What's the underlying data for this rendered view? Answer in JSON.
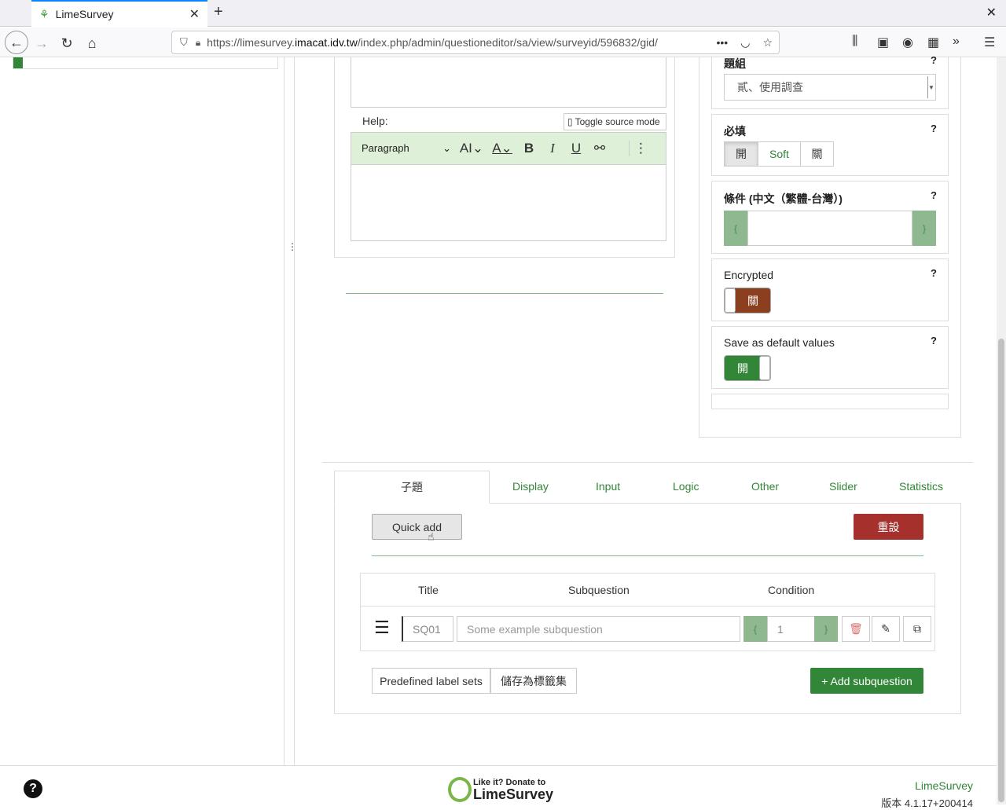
{
  "browser": {
    "tab_title": "LimeSurvey",
    "url_prefix": "https://limesurvey.",
    "url_domain": "imacat.idv.tw",
    "url_rest": "/index.php/admin/questioneditor/sa/view/surveyid/596832/gid/"
  },
  "editor": {
    "help_label": "Help:",
    "toggle_source": "Toggle source mode",
    "paragraph": "Paragraph"
  },
  "settings": {
    "group_label": "題組",
    "group_value": "貳、使用調查",
    "mandatory_label": "必填",
    "mandatory_options": [
      "開",
      "Soft",
      "關"
    ],
    "condition_label": "條件 (中文（繁體-台灣）)",
    "encrypted_label": "Encrypted",
    "encrypted_state": "關",
    "save_default_label": "Save as default values",
    "save_default_state": "開",
    "help_mark": "?"
  },
  "tabs": {
    "active": "子題",
    "others": [
      "Display",
      "Input",
      "Logic",
      "Other",
      "Slider",
      "Statistics"
    ]
  },
  "subquestions": {
    "quick_add": "Quick add",
    "reset": "重設",
    "headers": [
      "Title",
      "Subquestion",
      "Condition"
    ],
    "row": {
      "title": "SQ01",
      "placeholder": "Some example subquestion",
      "condition": "1"
    },
    "predefined": "Predefined label sets",
    "save_label_set": "儲存為標籤集",
    "add_subquestion": "+ Add subquestion"
  },
  "footer": {
    "donate_line1": "Like it? Donate to",
    "donate_line2": "LimeSurvey",
    "link": "LimeSurvey",
    "version": "版本 4.1.17+200414"
  },
  "colors": {
    "green": "#328637",
    "red": "#a6302c",
    "brown": "#8b3f1e"
  }
}
